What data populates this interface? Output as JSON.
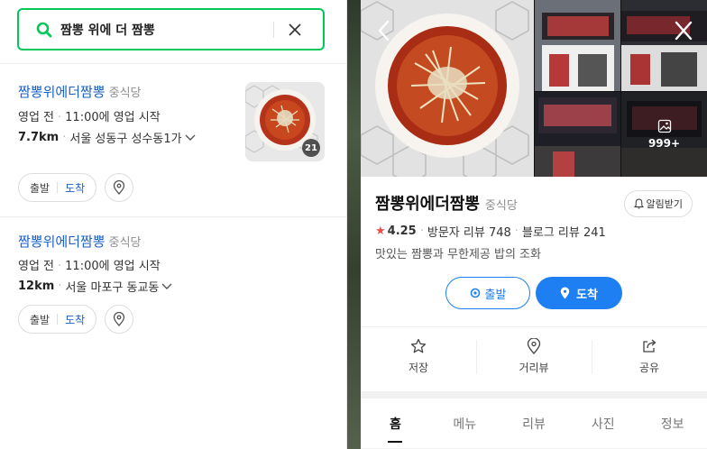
{
  "search": {
    "query": "짬뽕 위에 더 짬뽕"
  },
  "results": [
    {
      "name": "짬뽕위에더짬뽕",
      "category": "중식당",
      "status": "영업 전",
      "open_time": "11:00에 영업 시작",
      "distance": "7.7km",
      "address": "서울 성동구 성수동1가",
      "depart_label": "출발",
      "arrive_label": "도착",
      "photo_count": "21"
    },
    {
      "name": "짬뽕위에더짬뽕",
      "category": "중식당",
      "status": "영업 전",
      "open_time": "11:00에 영업 시작",
      "distance": "12km",
      "address": "서울 마포구 동교동",
      "depart_label": "출발",
      "arrive_label": "도착"
    }
  ],
  "detail": {
    "photos_more": "999+",
    "name": "짬뽕위에더짬뽕",
    "category": "중식당",
    "alarm_label": "알림받기",
    "rating": "4.25",
    "visitor_reviews": "방문자 리뷰 748",
    "blog_reviews": "블로그 리뷰 241",
    "description": "맛있는 짬뽕과 무한제공 밥의 조화",
    "depart_label": "출발",
    "arrive_label": "도착",
    "actions": [
      {
        "label": "저장",
        "icon": "star-outline-icon"
      },
      {
        "label": "거리뷰",
        "icon": "streetview-pin-icon"
      },
      {
        "label": "공유",
        "icon": "share-icon"
      }
    ],
    "tabs": [
      "홈",
      "메뉴",
      "리뷰",
      "사진",
      "정보"
    ],
    "active_tab": "홈"
  },
  "colors": {
    "accent_green": "#03c75a",
    "accent_blue": "#1d7ff2",
    "link_blue": "#1a62c5",
    "star_red": "#f04a4a"
  }
}
